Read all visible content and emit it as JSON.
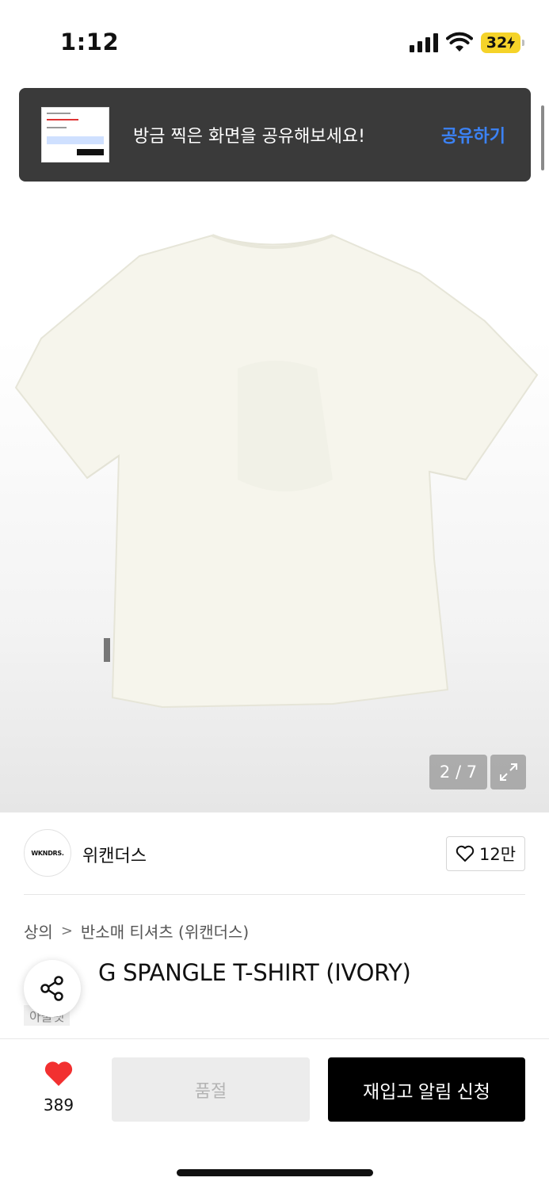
{
  "status_bar": {
    "time": "1:12",
    "battery": "32"
  },
  "toast": {
    "message": "방금 찍은 화면을 공유해보세요!",
    "action": "공유하기",
    "action_color": "#3b82f6"
  },
  "image_viewer": {
    "pager": "2 / 7",
    "current_index": 2,
    "total": 7,
    "product_color": "#f5f4ea"
  },
  "brand": {
    "logo_text": "WKNDRS.",
    "name": "위캔더스",
    "likes": "12만"
  },
  "breadcrumb": {
    "category": "상의",
    "subcategory": "반소매 티셔츠 (위캔더스)"
  },
  "product": {
    "title": "G SPANGLE T-SHIRT (IVORY)",
    "tag": "아울렛"
  },
  "bottom_bar": {
    "wish_count": "389",
    "soldout_label": "품절",
    "restock_label": "재입고 알림 신청",
    "heart_color": "#f23030"
  }
}
